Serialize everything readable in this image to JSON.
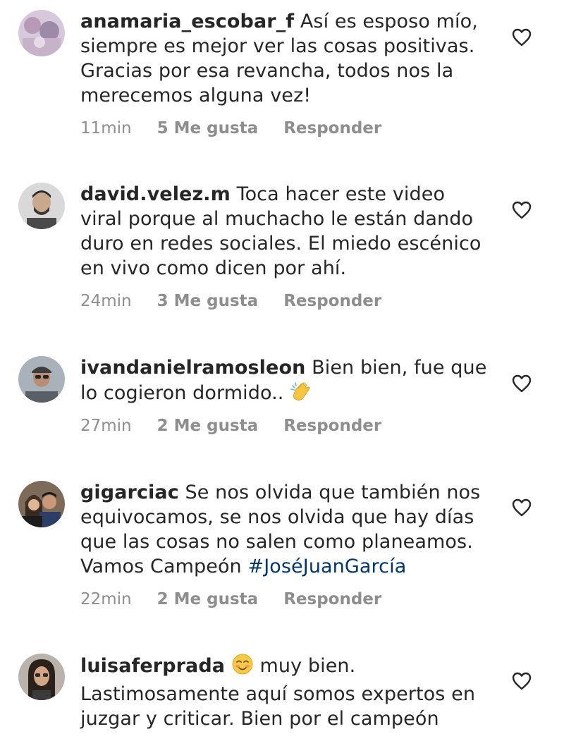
{
  "comments": [
    {
      "username": "anamaria_escobar_f",
      "text": "Así es esposo mío, siempre es mejor ver las cosas positivas. Gracias por esa revancha, todos nos la merecemos alguna vez!",
      "time": "11min",
      "likes": "5 Me gusta",
      "reply": "Responder",
      "avatar_icon": "user-avatar"
    },
    {
      "username": "david.velez.m",
      "text": "Toca hacer este video viral porque al muchacho le están dando duro en redes sociales. El miedo escénico en vivo como dicen por ahí.",
      "time": "24min",
      "likes": "3 Me gusta",
      "reply": "Responder",
      "avatar_icon": "user-avatar"
    },
    {
      "username": "ivandanielramosleon",
      "text": "Bien bien, fue que lo cogieron dormido..",
      "emoji": "clapping-hands-emoji",
      "time": "27min",
      "likes": "2 Me gusta",
      "reply": "Responder",
      "avatar_icon": "user-avatar"
    },
    {
      "username": "gigarciac",
      "text": "Se nos olvida que también nos equivocamos, se nos olvida que hay días que las cosas no salen como planeamos. Vamos Campeón",
      "hashtag": "#JoséJuanGarcía",
      "time": "22min",
      "likes": "2 Me gusta",
      "reply": "Responder",
      "avatar_icon": "user-avatar"
    },
    {
      "username": "luisaferprada",
      "emoji": "smiling-face-emoji",
      "text": "muy bien. Lastimosamente aquí somos expertos en juzgar y criticar.  Bien por el campeón",
      "avatar_icon": "user-avatar"
    }
  ],
  "colors": {
    "text": "#262626",
    "meta": "#8e8e8e",
    "hashtag": "#00376b",
    "background": "#ffffff"
  },
  "icons": {
    "like": "heart-outline-icon"
  }
}
